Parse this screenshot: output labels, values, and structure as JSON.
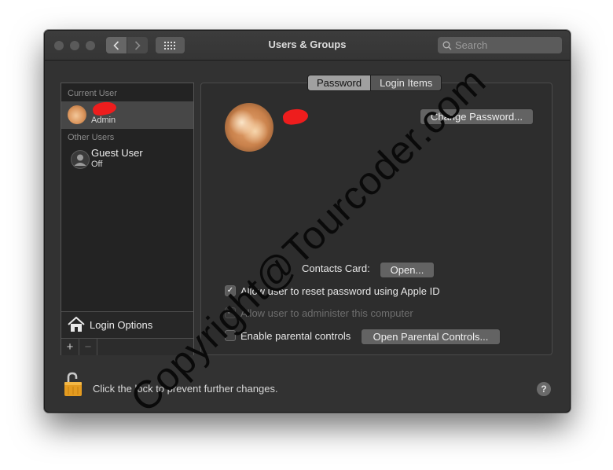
{
  "window": {
    "title": "Users & Groups"
  },
  "toolbar": {
    "search_placeholder": "Search"
  },
  "sidebar": {
    "current_user_label": "Current User",
    "current_user": {
      "role": "Admin"
    },
    "other_users_label": "Other Users",
    "other_users": [
      {
        "name": "Guest User",
        "status": "Off"
      }
    ],
    "login_options_label": "Login Options",
    "add_label": "+",
    "remove_label": "−"
  },
  "tabs": [
    {
      "label": "Password",
      "selected": true
    },
    {
      "label": "Login Items",
      "selected": false
    }
  ],
  "panel": {
    "change_password_label": "Change Password...",
    "contacts_card_label": "Contacts Card:",
    "open_label": "Open...",
    "checkboxes": [
      {
        "label": "Allow user to reset password using Apple ID",
        "checked": true,
        "enabled": true
      },
      {
        "label": "Allow user to administer this computer",
        "checked": true,
        "enabled": false
      },
      {
        "label": "Enable parental controls",
        "checked": false,
        "enabled": true
      }
    ],
    "open_parental_controls_label": "Open Parental Controls..."
  },
  "footer": {
    "lock_text": "Click the lock to prevent further changes.",
    "help_label": "?"
  },
  "watermark": {
    "text": "Copyright@Tourcoder.com"
  }
}
